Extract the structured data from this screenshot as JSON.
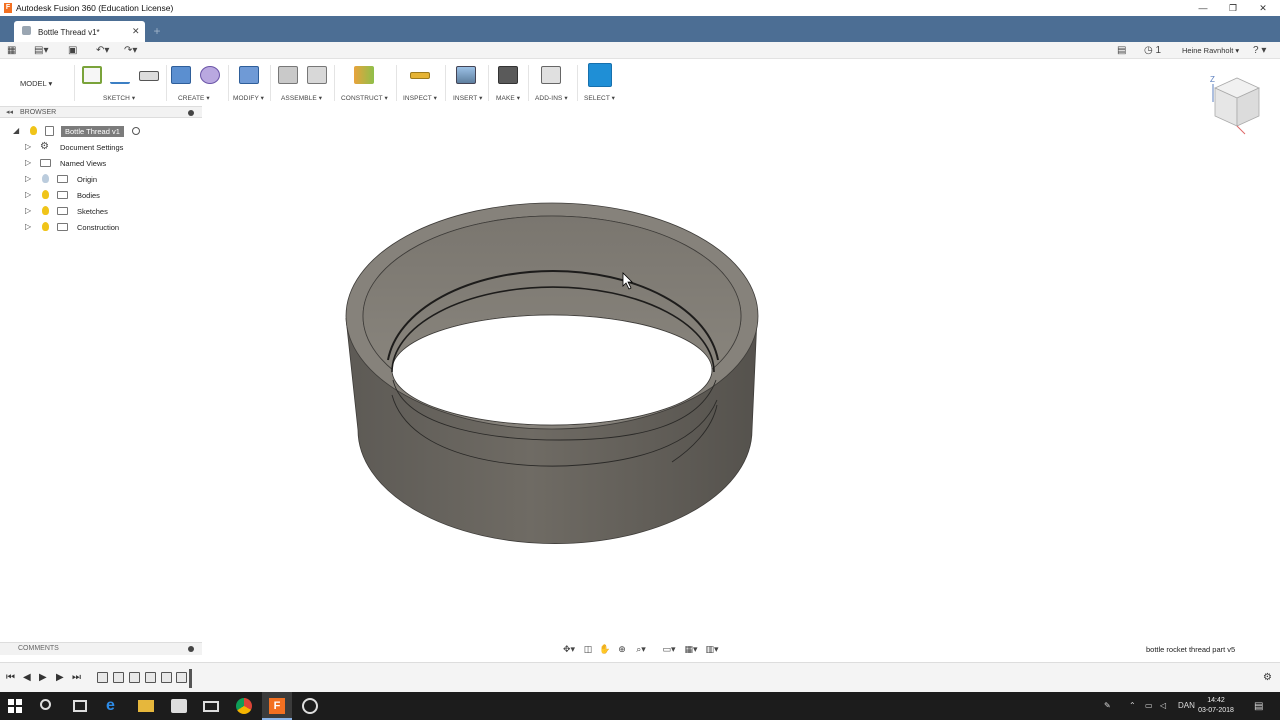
{
  "window": {
    "title": "Autodesk Fusion 360 (Education License)",
    "minimize": "—",
    "restore": "❐",
    "close": "✕"
  },
  "tab": {
    "label": "Bottle Thread v1*",
    "close": "✕",
    "new": "+"
  },
  "qat": {
    "grid": "▦",
    "file": "▤▾",
    "save": "▣",
    "undo": "↶▾",
    "redo": "↷▾",
    "chat": "▤",
    "history": "◷ 1",
    "user": "Heine Ravnholt ▾",
    "help": "? ▾"
  },
  "ribbon": {
    "workspace": "MODEL ▾",
    "groups": [
      {
        "label": "SKETCH ▾"
      },
      {
        "label": "CREATE ▾"
      },
      {
        "label": "MODIFY ▾"
      },
      {
        "label": "ASSEMBLE ▾"
      },
      {
        "label": "CONSTRUCT ▾"
      },
      {
        "label": "INSPECT ▾"
      },
      {
        "label": "INSERT ▾"
      },
      {
        "label": "MAKE ▾"
      },
      {
        "label": "ADD-INS ▾"
      },
      {
        "label": "SELECT ▾"
      }
    ]
  },
  "browser": {
    "title": "BROWSER",
    "root": "Bottle Thread v1",
    "items": [
      {
        "label": "Document Settings"
      },
      {
        "label": "Named Views"
      },
      {
        "label": "Origin"
      },
      {
        "label": "Bodies"
      },
      {
        "label": "Sketches"
      },
      {
        "label": "Construction"
      }
    ]
  },
  "comments": {
    "title": "COMMENTS"
  },
  "status": {
    "text": "bottle rocket thread part v5"
  },
  "nav": {
    "orbit": "✥▾",
    "look": "◫",
    "pan": "✋",
    "zoom": "⊕",
    "fit": "⌕▾",
    "display": "▭▾",
    "grid": "▦▾",
    "viewports": "▥▾"
  },
  "timeline": {
    "first": "⏮",
    "prev": "◀",
    "play": "▶",
    "next": "▶",
    "last": "⏭",
    "settings": "⚙"
  },
  "taskbar": {
    "lang": "DAN",
    "time": "14:42",
    "date": "03-07-2018"
  },
  "viewcube": {
    "axis_label": "Z"
  },
  "colors": {
    "tabbar": "#4c6e94",
    "select_accent": "#1f8fd6",
    "model_body": "#6b6760",
    "taskbar": "#1c1c1c"
  }
}
